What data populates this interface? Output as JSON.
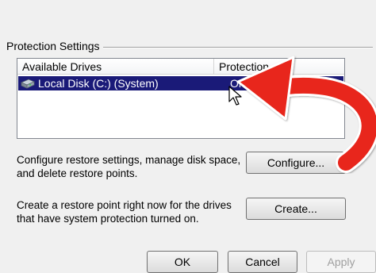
{
  "section": {
    "title": "Protection Settings"
  },
  "drives_list": {
    "columns": [
      "Available Drives",
      "Protection"
    ],
    "rows": [
      {
        "drive": "Local Disk (C:) (System)",
        "protection": "On",
        "icon": "hard-drive-icon",
        "selected": true
      }
    ]
  },
  "configure": {
    "description": "Configure restore settings, manage disk space, and delete restore points.",
    "button_label": "Configure..."
  },
  "create": {
    "description": "Create a restore point right now for the drives that have system protection turned on.",
    "button_label": "Create..."
  },
  "dialog_buttons": {
    "ok": "OK",
    "cancel": "Cancel",
    "apply": "Apply"
  },
  "colors": {
    "selection": "#1a1a78",
    "annotation_arrow": "#e8271c",
    "background": "#f0f0f0"
  }
}
